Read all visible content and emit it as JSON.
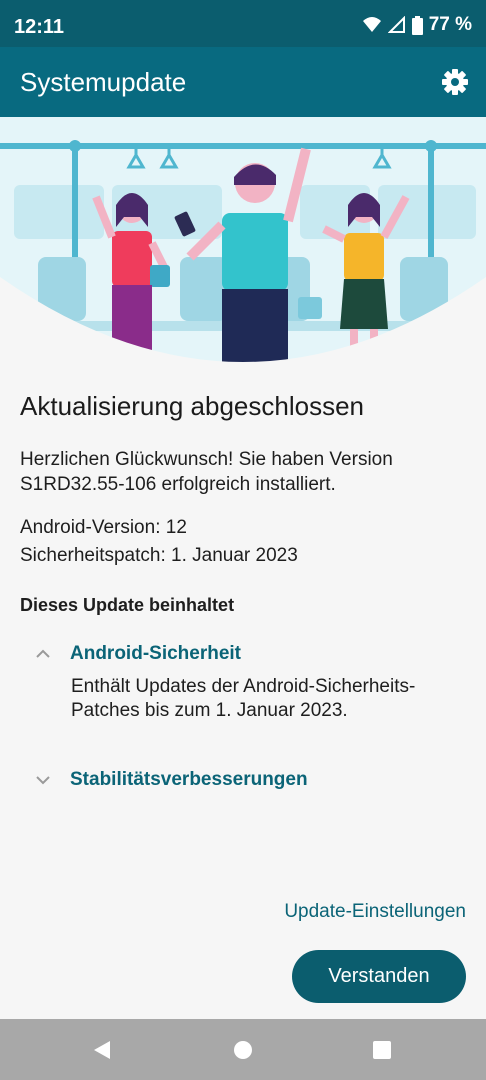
{
  "status": {
    "time": "12:11",
    "battery": "77 %",
    "icons": [
      "wifi-icon",
      "signal-icon",
      "battery-icon"
    ]
  },
  "appbar": {
    "title": "Systemupdate",
    "settings_icon": "gear-icon"
  },
  "main": {
    "headline": "Aktualisierung abgeschlossen",
    "intro": "Herzlichen Glückwunsch! Sie haben Version S1RD32.55-106 erfolgreich installiert.",
    "android_version": "Android-Version: 12",
    "security_patch": "Sicherheitspatch: 1. Januar 2023",
    "includes_heading": "Dieses Update beinhaltet",
    "sections": [
      {
        "title": "Android-Sicherheit",
        "expanded": true,
        "body": "Enthält Updates der Android-Sicherheits-Patches bis zum 1. Januar 2023."
      },
      {
        "title": "Stabilitätsverbesserungen",
        "expanded": false
      }
    ]
  },
  "actions": {
    "settings_link": "Update-Einstellungen",
    "confirm_button": "Verstanden"
  },
  "navbar": {
    "icons": [
      "back-icon",
      "home-icon",
      "recents-icon"
    ]
  },
  "colors": {
    "status_bar": "#0b5d6e",
    "app_bar": "#086a80",
    "accent_text": "#0b6477",
    "button": "#0b5d6e"
  }
}
